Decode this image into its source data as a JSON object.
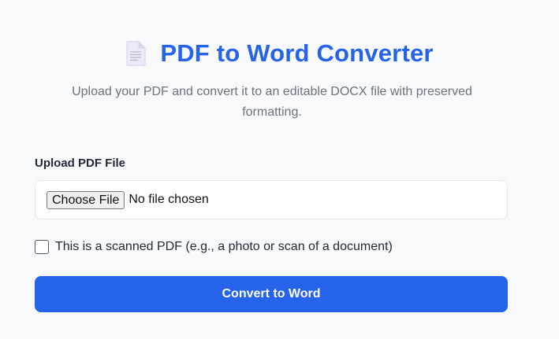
{
  "header": {
    "icon": "document-icon",
    "title": "PDF to Word Converter",
    "subtitle": "Upload your PDF and convert it to an editable DOCX file with preserved formatting."
  },
  "upload": {
    "label": "Upload PDF File",
    "choose_button": "Choose File",
    "status": "No file chosen"
  },
  "scanned_option": {
    "label": "This is a scanned PDF (e.g., a photo or scan of a document)",
    "checked": false
  },
  "convert_button": "Convert to Word",
  "colors": {
    "accent": "#2563eb",
    "background": "#f8f9fb",
    "muted_text": "#6b7280"
  }
}
